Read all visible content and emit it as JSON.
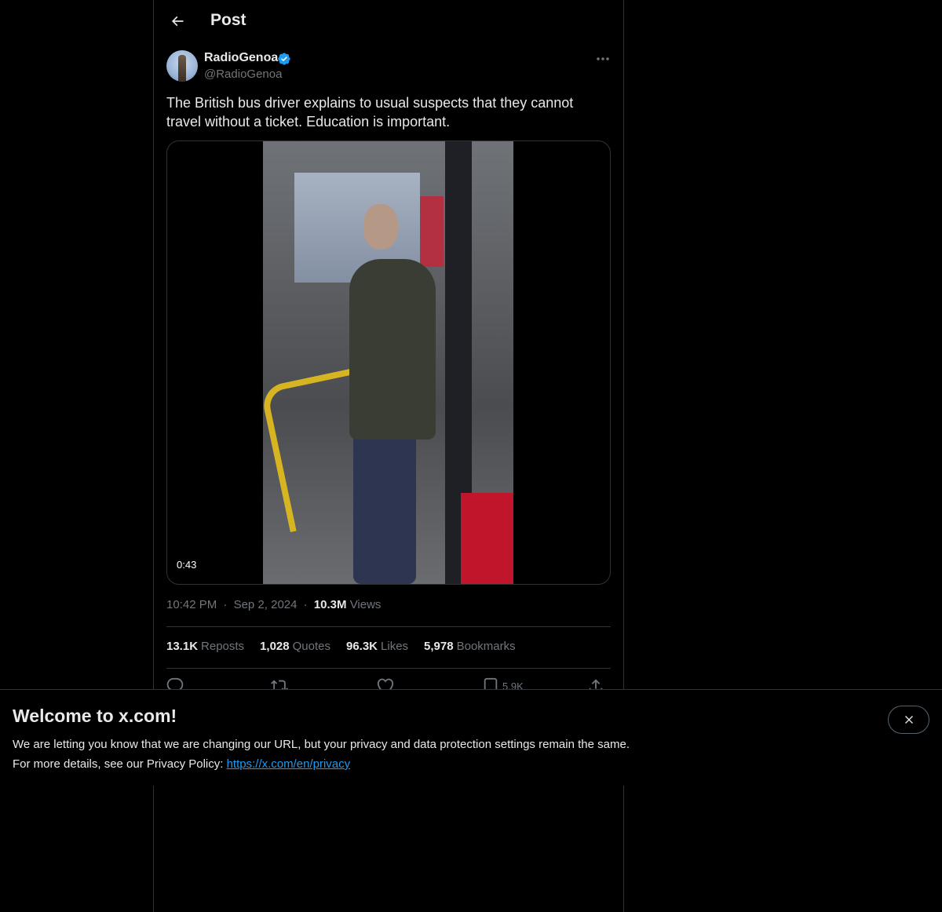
{
  "header": {
    "title": "Post"
  },
  "author": {
    "name": "RadioGenoa",
    "handle": "@RadioGenoa"
  },
  "post": {
    "text": "The British bus driver explains to usual suspects that they cannot travel without a ticket. Education is important.",
    "video_duration": "0:43",
    "time": "10:42 PM",
    "separator": "·",
    "date": "Sep 2, 2024",
    "views_count": "10.3M",
    "views_label": "Views"
  },
  "stats": [
    {
      "count": "13.1K",
      "label": "Reposts"
    },
    {
      "count": "1,028",
      "label": "Quotes"
    },
    {
      "count": "96.3K",
      "label": "Likes"
    },
    {
      "count": "5,978",
      "label": "Bookmarks"
    }
  ],
  "actions": {
    "bookmark_count": "5.9K"
  },
  "banner": {
    "title": "Welcome to x.com!",
    "line1": "We are letting you know that we are changing our URL, but your privacy and data protection settings remain the same.",
    "line2_prefix": "For more details, see our Privacy Policy: ",
    "link": "https://x.com/en/privacy"
  },
  "colors": {
    "accent": "#1d9bf0",
    "background": "#000000",
    "muted": "#71767b"
  }
}
